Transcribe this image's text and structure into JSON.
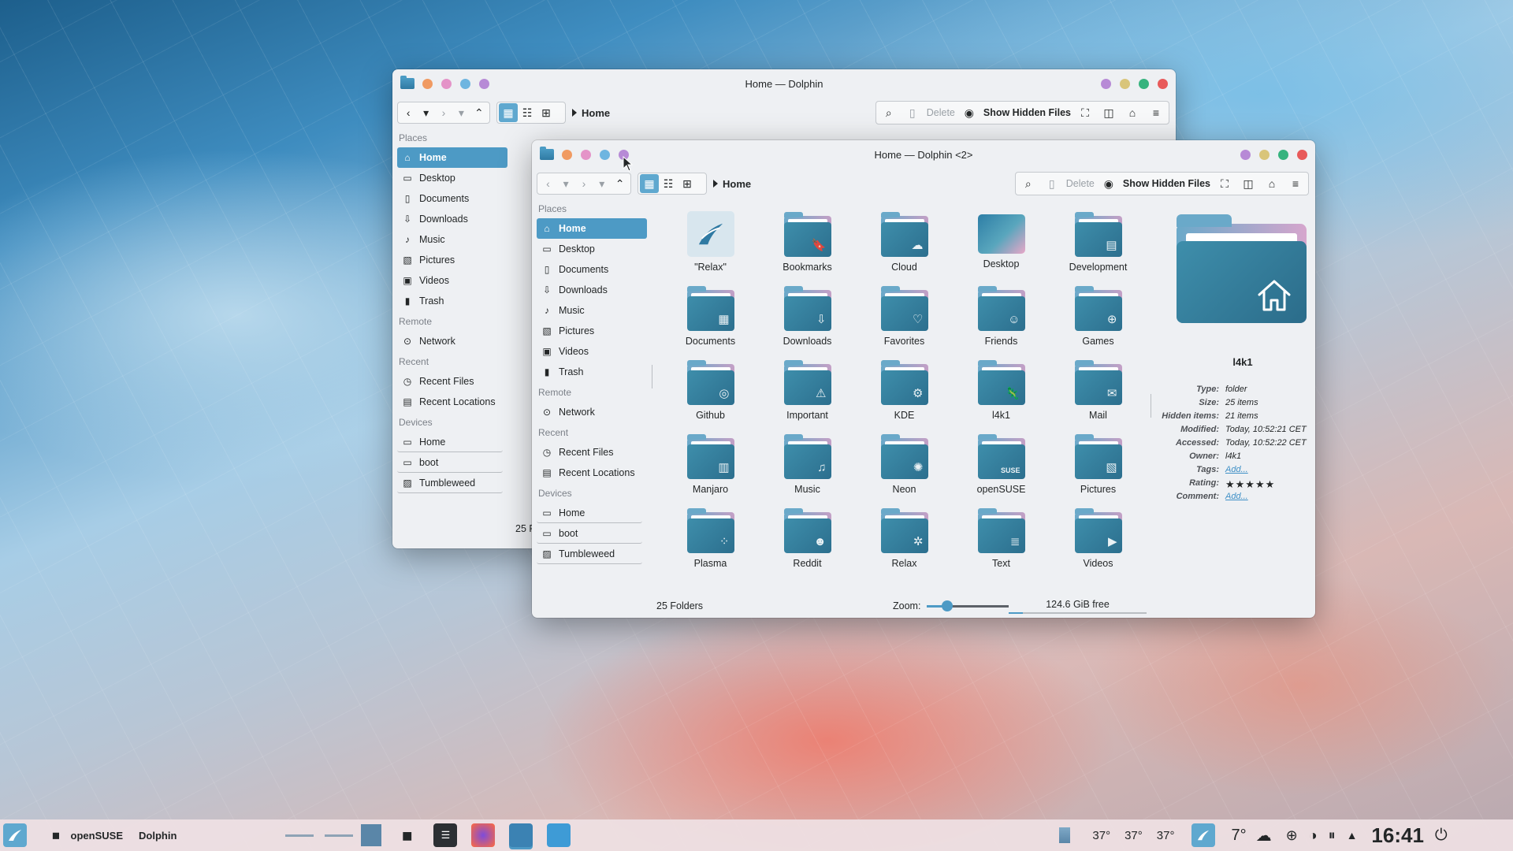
{
  "back_window": {
    "title": "Home — Dolphin",
    "breadcrumb": "Home",
    "toolbar": {
      "delete": "Delete",
      "show_hidden": "Show Hidden Files"
    },
    "places_title": "Places",
    "places": [
      "Home",
      "Desktop",
      "Documents",
      "Downloads",
      "Music",
      "Pictures",
      "Videos",
      "Trash"
    ],
    "remote_title": "Remote",
    "remote": [
      "Network"
    ],
    "recent_title": "Recent",
    "recent": [
      "Recent Files",
      "Recent Locations"
    ],
    "devices_title": "Devices",
    "devices": [
      "Home",
      "boot",
      "Tumbleweed"
    ],
    "status_partial": "25 F"
  },
  "front_window": {
    "title": "Home — Dolphin <2>",
    "breadcrumb": "Home",
    "toolbar": {
      "delete": "Delete",
      "show_hidden": "Show Hidden Files"
    },
    "places_title": "Places",
    "places": [
      "Home",
      "Desktop",
      "Documents",
      "Downloads",
      "Music",
      "Pictures",
      "Videos",
      "Trash"
    ],
    "remote_title": "Remote",
    "remote": [
      "Network"
    ],
    "recent_title": "Recent",
    "recent": [
      "Recent Files",
      "Recent Locations"
    ],
    "devices_title": "Devices",
    "devices": [
      "Home",
      "boot",
      "Tumbleweed"
    ],
    "files": [
      {
        "name": "\"Relax\"",
        "icon": "relax-launcher-icon",
        "glyph": ""
      },
      {
        "name": "Bookmarks",
        "icon": "bookmark-icon",
        "glyph": "🔖"
      },
      {
        "name": "Cloud",
        "icon": "cloud-icon",
        "glyph": "☁"
      },
      {
        "name": "Desktop",
        "icon": "desktop-icon",
        "glyph": ""
      },
      {
        "name": "Development",
        "icon": "development-icon",
        "glyph": "▤"
      },
      {
        "name": "Documents",
        "icon": "documents-icon",
        "glyph": "▦"
      },
      {
        "name": "Downloads",
        "icon": "download-icon",
        "glyph": "⇩"
      },
      {
        "name": "Favorites",
        "icon": "heart-icon",
        "glyph": "♡"
      },
      {
        "name": "Friends",
        "icon": "friends-icon",
        "glyph": "☺"
      },
      {
        "name": "Games",
        "icon": "gamepad-icon",
        "glyph": "⊕"
      },
      {
        "name": "Github",
        "icon": "github-icon",
        "glyph": "◎"
      },
      {
        "name": "Important",
        "icon": "warning-icon",
        "glyph": "⚠"
      },
      {
        "name": "KDE",
        "icon": "kde-icon",
        "glyph": "⚙"
      },
      {
        "name": "l4k1",
        "icon": "chameleon-icon",
        "glyph": "🦎"
      },
      {
        "name": "Mail",
        "icon": "mail-icon",
        "glyph": "✉"
      },
      {
        "name": "Manjaro",
        "icon": "manjaro-icon",
        "glyph": "▥"
      },
      {
        "name": "Music",
        "icon": "music-icon",
        "glyph": "♫"
      },
      {
        "name": "Neon",
        "icon": "neon-icon",
        "glyph": "✺"
      },
      {
        "name": "openSUSE",
        "icon": "opensuse-icon",
        "glyph": "SUSE"
      },
      {
        "name": "Pictures",
        "icon": "pictures-icon",
        "glyph": "▧"
      },
      {
        "name": "Plasma",
        "icon": "plasma-icon",
        "glyph": "⁘"
      },
      {
        "name": "Reddit",
        "icon": "reddit-icon",
        "glyph": "☻"
      },
      {
        "name": "Relax",
        "icon": "leaf-icon",
        "glyph": "✲"
      },
      {
        "name": "Text",
        "icon": "text-file-icon",
        "glyph": "≣"
      },
      {
        "name": "Videos",
        "icon": "video-icon",
        "glyph": "▶"
      }
    ],
    "info": {
      "name": "l4k1",
      "properties": [
        {
          "key": "Type:",
          "value": "folder"
        },
        {
          "key": "Size:",
          "value": "25 items"
        },
        {
          "key": "Hidden items:",
          "value": "21 items"
        },
        {
          "key": "Modified:",
          "value": "Today, 10:52:21 CET"
        },
        {
          "key": "Accessed:",
          "value": "Today, 10:52:22 CET"
        },
        {
          "key": "Owner:",
          "value": "l4k1"
        },
        {
          "key": "Tags:",
          "value": "Add..."
        },
        {
          "key": "Rating:",
          "value": "★★★★★"
        },
        {
          "key": "Comment:",
          "value": "Add..."
        }
      ]
    },
    "status": {
      "count": "25 Folders",
      "zoom_label": "Zoom:",
      "zoom_level": 0.25,
      "free_space": "124.6 GiB free",
      "used_fraction": 0.1
    }
  },
  "taskbar": {
    "activity": "openSUSE",
    "app": "Dolphin",
    "temps": [
      "37°",
      "37°",
      "37°"
    ],
    "weather": "7°",
    "clock": "16:41"
  },
  "colors": {
    "accent": "#4d9ac5",
    "close": "#e85a5a",
    "minimize": "#d9c57a",
    "maximize": "#36b37e",
    "pink": "#e493c8",
    "blue": "#6eb5e0",
    "purple": "#b78ad6"
  }
}
